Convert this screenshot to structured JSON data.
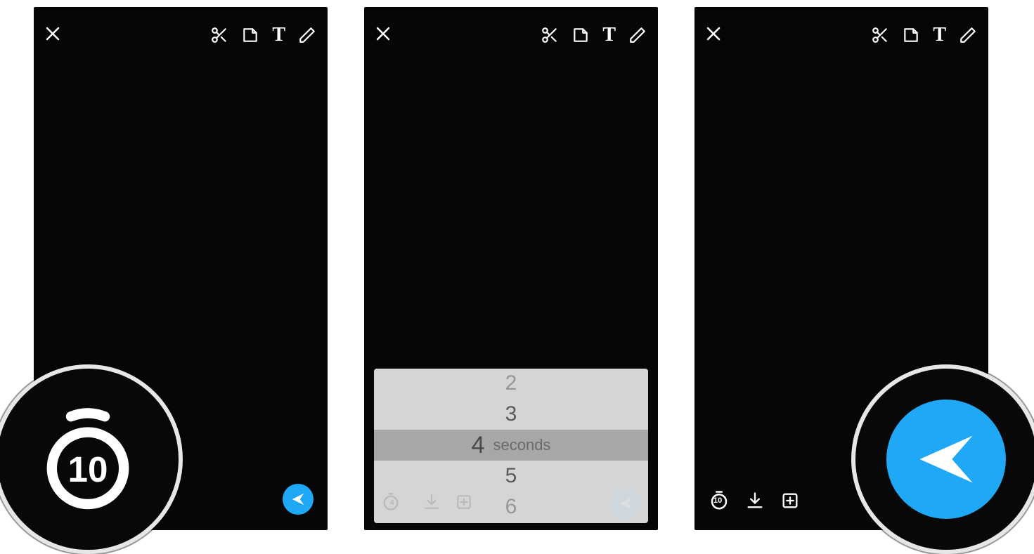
{
  "top_tools": {
    "close": "×",
    "scissors": "scissors-icon",
    "sticker": "sticker-icon",
    "text": "T",
    "draw": "pencil-icon"
  },
  "screen1": {
    "timer_value": "10"
  },
  "screen2": {
    "picker": {
      "opt_a": "2",
      "opt_b": "3",
      "selected": "4",
      "unit": "seconds",
      "opt_c": "5",
      "opt_d": "6",
      "ghost_timer": "4"
    }
  },
  "screen3": {
    "timer_value": "10"
  },
  "colors": {
    "accent": "#1fa8f5"
  }
}
